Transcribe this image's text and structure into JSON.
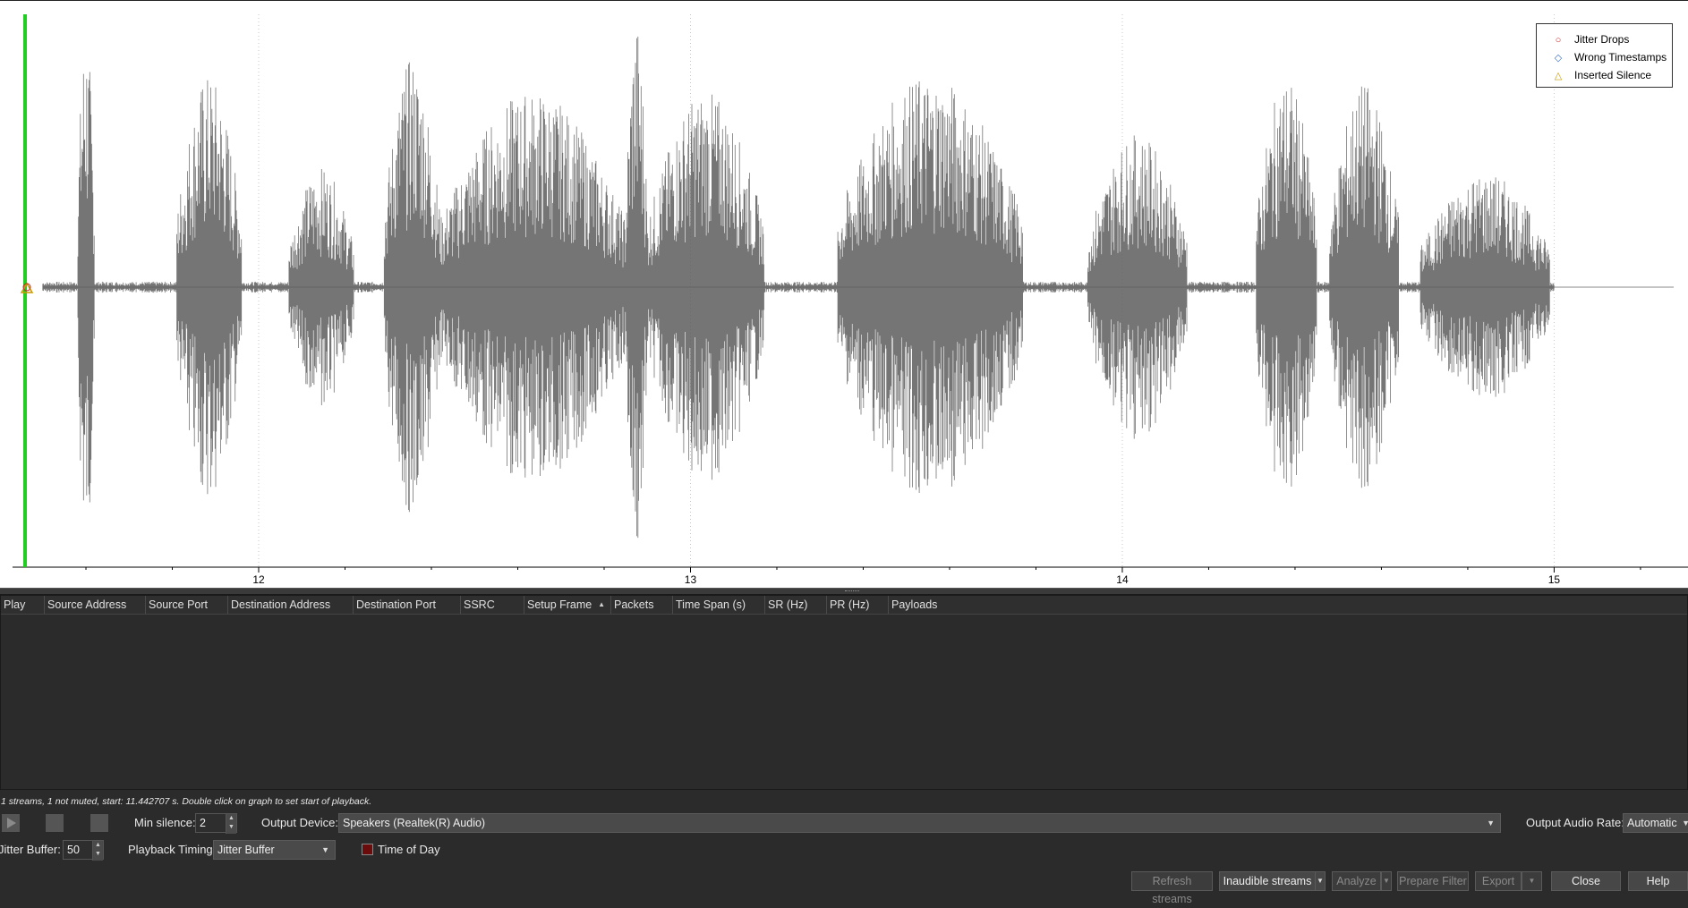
{
  "legend": {
    "items": [
      {
        "label": "Jitter Drops",
        "symbol": "○",
        "color": "#cc2222"
      },
      {
        "label": "Wrong Timestamps",
        "symbol": "◇",
        "color": "#3a6fc4"
      },
      {
        "label": "Inserted Silence",
        "symbol": "△",
        "color": "#c99a00"
      }
    ]
  },
  "chart_data": {
    "type": "line",
    "series": [
      {
        "name": "",
        "color": "#5a5a5a"
      }
    ],
    "xlim": [
      11.43,
      15.31
    ],
    "x_tick_labels": [
      "12",
      "13",
      "14",
      "15"
    ],
    "x_ticks": [
      12,
      13,
      14,
      15
    ],
    "playback_marker_color": "#22cc22",
    "grid": "vertical dotted at major ticks",
    "legend_position": "top-right",
    "speech_bursts": [
      {
        "start": 11.58,
        "end": 11.62,
        "amplitude": 0.95
      },
      {
        "start": 11.81,
        "end": 11.96,
        "amplitude": 0.78
      },
      {
        "start": 12.07,
        "end": 12.22,
        "amplitude": 0.44
      },
      {
        "start": 12.29,
        "end": 12.42,
        "amplitude": 0.84
      },
      {
        "start": 12.42,
        "end": 12.85,
        "amplitude": 0.72
      },
      {
        "start": 12.85,
        "end": 12.9,
        "amplitude": 0.98
      },
      {
        "start": 12.9,
        "end": 13.17,
        "amplitude": 0.72
      },
      {
        "start": 13.34,
        "end": 13.77,
        "amplitude": 0.78
      },
      {
        "start": 13.92,
        "end": 14.15,
        "amplitude": 0.56
      },
      {
        "start": 14.31,
        "end": 14.45,
        "amplitude": 0.77
      },
      {
        "start": 14.48,
        "end": 14.64,
        "amplitude": 0.75
      },
      {
        "start": 14.69,
        "end": 14.99,
        "amplitude": 0.42
      }
    ]
  },
  "table": {
    "columns": [
      "Play",
      "Source Address",
      "Source Port",
      "Destination Address",
      "Destination Port",
      "SSRC",
      "Setup Frame",
      "Packets",
      "Time Span (s)",
      "SR (Hz)",
      "PR (Hz)",
      "Payloads"
    ]
  },
  "status_text": "1 streams, 1 not muted, start: 11.442707 s. Double click on graph to set start of playback.",
  "controls": {
    "min_silence_label": "Min silence:",
    "min_silence_value": "2",
    "output_device_label": "Output Device:",
    "output_device_value": "Speakers (Realtek(R) Audio)",
    "output_audio_rate_label": "Output Audio Rate:",
    "output_audio_rate_value": "Automatic",
    "jitter_buffer_label": "Jitter Buffer:",
    "jitter_buffer_value": "50",
    "playback_timing_label": "Playback Timing:",
    "playback_timing_value": "Jitter Buffer",
    "time_of_day_label": "Time of Day"
  },
  "buttons": {
    "refresh_streams": "Refresh streams",
    "inaudible_streams": "Inaudible streams",
    "analyze": "Analyze",
    "prepare_filter": "Prepare Filter",
    "export": "Export",
    "close": "Close",
    "help": "Help"
  }
}
